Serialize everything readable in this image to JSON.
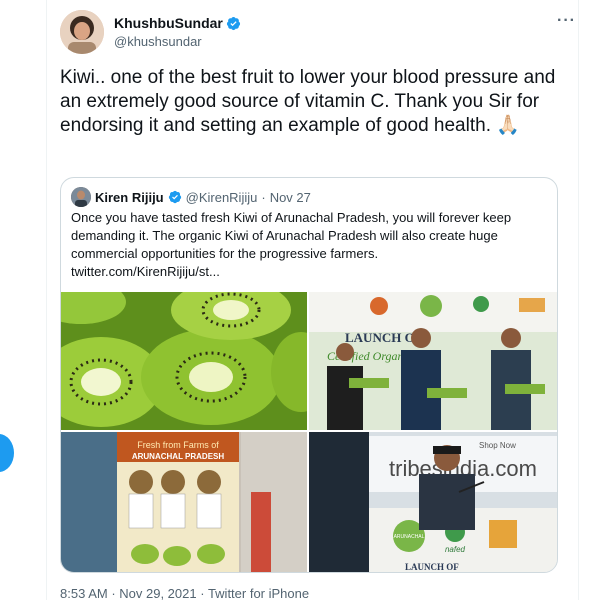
{
  "tweet": {
    "display_name": "KhushbuSundar",
    "handle": "@khushsundar",
    "more_label": "···",
    "text": "Kiwi.. one of the best fruit to lower your blood pressure and an extremely good source of vitamin C. Thank you Sir for endorsing it and setting an example of good health. 🙏🏻",
    "footer_time": "8:53 AM",
    "footer_sep1": " · ",
    "footer_date": "Nov 29, 2021",
    "footer_sep2": " · ",
    "footer_source": "Twitter for iPhone"
  },
  "quote": {
    "display_name": "Kiren Rijiju",
    "handle": "@KirenRijiju",
    "separator": "·",
    "date": "Nov 27",
    "text": "Once you have tasted fresh Kiwi of Arunachal Pradesh, you will forever keep demanding it. The organic Kiwi of Arunachal Pradesh will also create huge commercial opportunities for the progressive farmers.",
    "link": "twitter.com/KirenRijiju/st..."
  },
  "images": {
    "banner_launch": "LAUNCH OF",
    "banner_organic": "Certified Organic",
    "box_farms_line1": "Fresh from Farms of",
    "box_farms_line2": "ARUNACHAL PRADESH",
    "store_sign": "tribesindia.com",
    "store_sign_top": "Shop Now",
    "logo_nafed": "nafed",
    "logo_arunachal": "ARUNACHAL",
    "banner_bottom": "LAUNCH OF"
  },
  "colors": {
    "accent": "#1d9bf0",
    "text": "#0f1419",
    "muted": "#536471",
    "border": "#cfd9de",
    "kiwi_green": "#7bb52a"
  }
}
